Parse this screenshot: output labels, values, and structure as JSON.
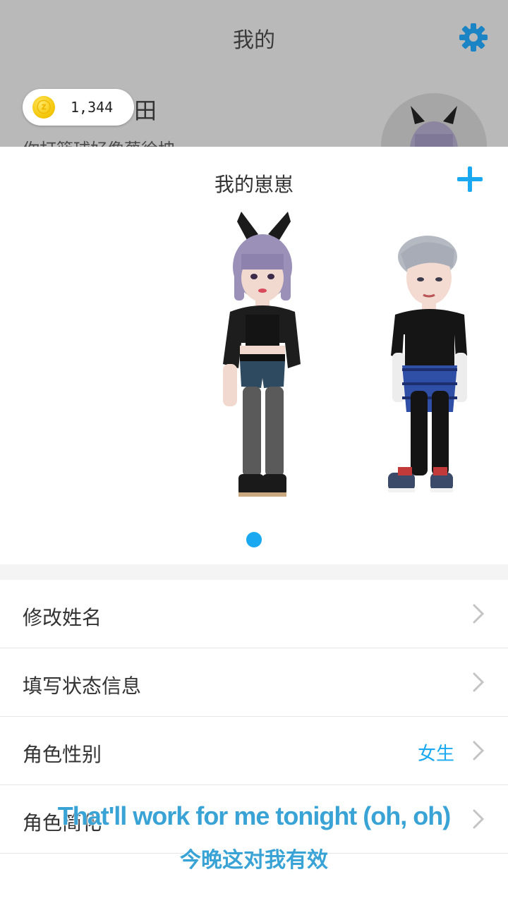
{
  "header": {
    "title": "我的"
  },
  "profile": {
    "coins": "1,344",
    "name_peek": "田",
    "status_peek": "你打篮球好像蔡徐坤"
  },
  "sheet": {
    "title": "我的崽崽",
    "page_indicator": {
      "current": 1,
      "total": 1
    }
  },
  "menu": {
    "items": [
      {
        "label": "修改姓名",
        "value": ""
      },
      {
        "label": "填写状态信息",
        "value": ""
      },
      {
        "label": "角色性别",
        "value": "女生"
      },
      {
        "label": "角色简化",
        "value": ""
      }
    ]
  },
  "subtitles": {
    "english": "That'll work for me tonight (oh, oh)",
    "chinese": "今晚这对我有效"
  },
  "colors": {
    "accent": "#1aa9f0",
    "dim": "#b9b9b9",
    "gear": "#1a84c4"
  },
  "icons": [
    "gear-icon",
    "coin-icon",
    "plus-icon",
    "chevron-right-icon"
  ]
}
